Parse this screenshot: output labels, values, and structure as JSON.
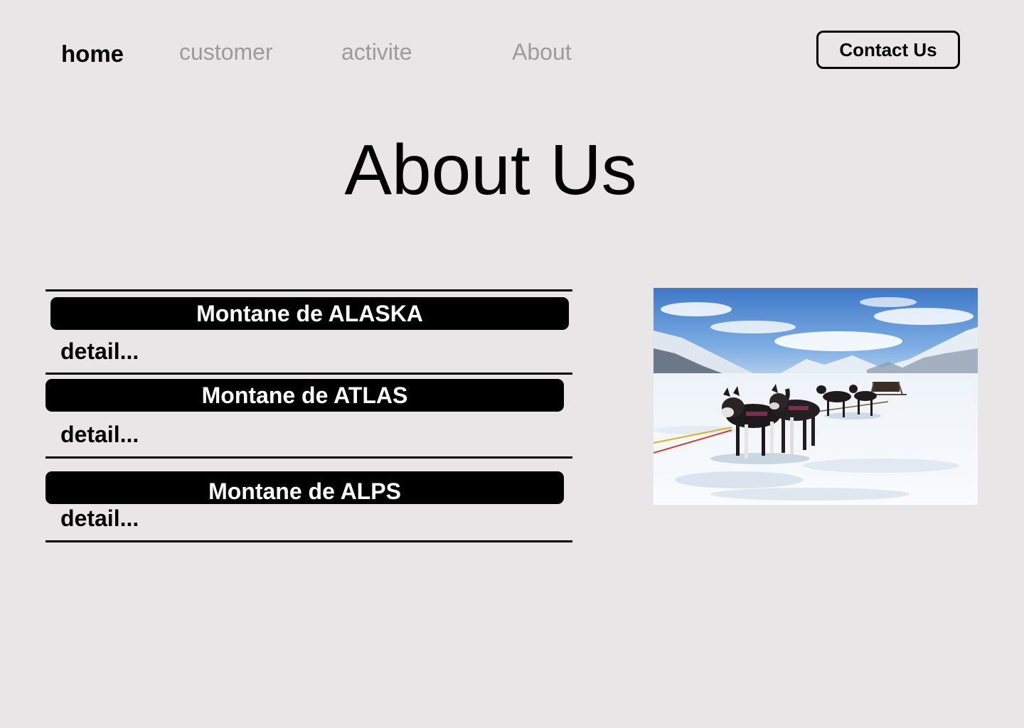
{
  "nav": {
    "items": [
      {
        "label": "home",
        "active": true
      },
      {
        "label": "customer",
        "active": false
      },
      {
        "label": "activite",
        "active": false
      },
      {
        "label": "About",
        "active": false
      }
    ],
    "contact_label": "Contact Us"
  },
  "page": {
    "title": "About Us"
  },
  "sections": [
    {
      "title": "Montane de ALASKA",
      "detail": "detail..."
    },
    {
      "title": "Montane de ATLAS",
      "detail": "detail..."
    },
    {
      "title": "Montane de ALPS",
      "detail": "detail..."
    }
  ],
  "colors": {
    "background": "#e8e6e7",
    "text": "#000000",
    "nav_inactive": "#9b9b9b",
    "header_bg": "#000000",
    "header_text": "#ffffff"
  },
  "photo": {
    "subject": "sled-dogs-on-snow-image"
  }
}
